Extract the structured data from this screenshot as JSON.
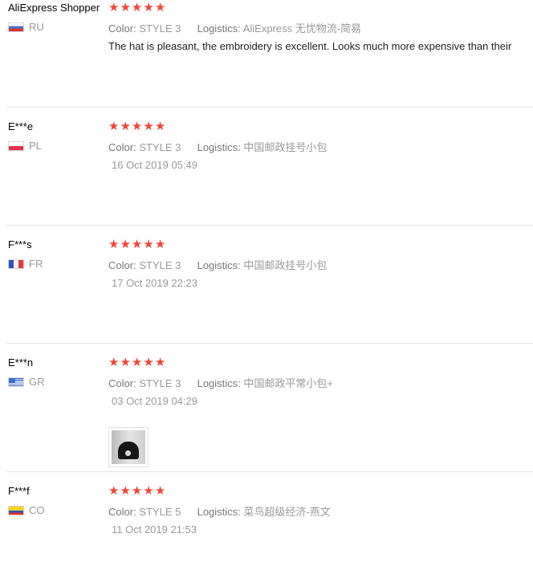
{
  "labels": {
    "color": "Color:",
    "logistics": "Logistics:"
  },
  "rating_symbol": "★",
  "accent_color": "#f44336",
  "reviews": [
    {
      "user": "AliExpress Shopper",
      "country": "RU",
      "flag_icon": "flag-ru",
      "stars": 5,
      "color": "STYLE 3",
      "logistics": "AliExpress 无忧物流-简易",
      "text": "The hat is pleasant, the embroidery is excellent. Looks much more expensive than their"
    },
    {
      "user": "E***e",
      "country": "PL",
      "flag_icon": "flag-pl",
      "stars": 5,
      "color": "STYLE 3",
      "logistics": "中国邮政挂号小包",
      "date": "16 Oct 2019 05:49"
    },
    {
      "user": "F***s",
      "country": "FR",
      "flag_icon": "flag-fr",
      "stars": 5,
      "color": "STYLE 3",
      "logistics": "中国邮政挂号小包",
      "date": "17 Oct 2019 22:23"
    },
    {
      "user": "E***n",
      "country": "GR",
      "flag_icon": "flag-gr",
      "stars": 5,
      "color": "STYLE 3",
      "logistics": "中国邮政平常小包+",
      "date": "03 Oct 2019 04:29",
      "photo_icon": "black-beanie-photo"
    },
    {
      "user": "F***f",
      "country": "CO",
      "flag_icon": "flag-co",
      "stars": 5,
      "color": "STYLE 5",
      "logistics": "菜鸟超级经济-燕文",
      "date": "11 Oct 2019 21:53"
    }
  ]
}
